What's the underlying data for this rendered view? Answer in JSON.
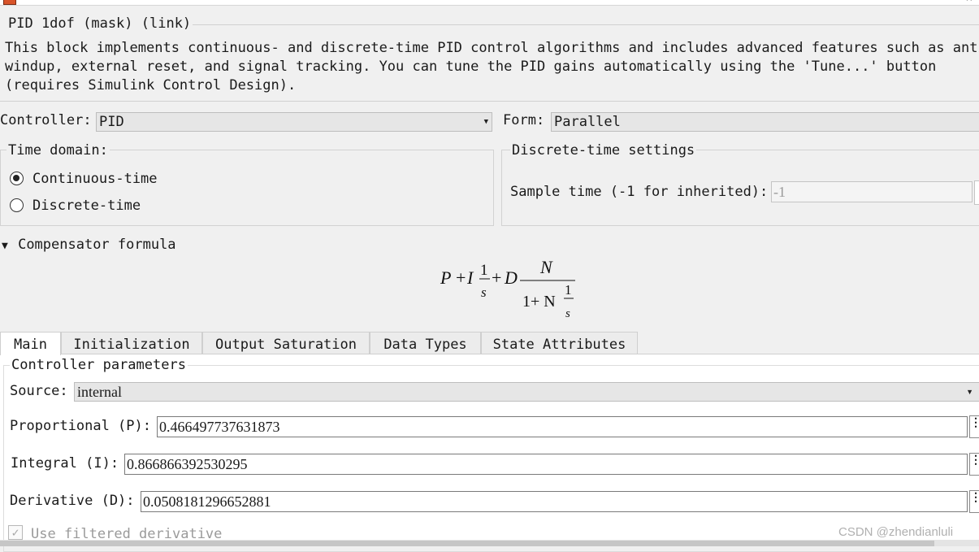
{
  "window": {
    "close_glyph": "×"
  },
  "block": {
    "title": "PID 1dof (mask) (link)",
    "description_lines": [
      "This block implements continuous- and discrete-time PID control algorithms and includes advanced features such as anti-",
      "windup, external reset, and signal tracking. You can tune the PID gains automatically using the 'Tune...' button",
      "(requires Simulink Control Design)."
    ]
  },
  "controller": {
    "label": "Controller:",
    "value": "PID"
  },
  "form": {
    "label": "Form:",
    "value": "Parallel"
  },
  "time_domain": {
    "label": "Time domain:",
    "options": [
      {
        "label": "Continuous-time",
        "selected": true
      },
      {
        "label": "Discrete-time",
        "selected": false
      }
    ]
  },
  "discrete_settings": {
    "label": "Discrete-time settings",
    "sample_time_label": "Sample time (-1 for inherited):",
    "sample_time_value": "-1"
  },
  "compensator": {
    "label": "Compensator formula",
    "formula": {
      "P": "P",
      "plus": "+",
      "I": "I",
      "one": "1",
      "s": "s",
      "D": "D",
      "N": "N",
      "denom_prefix": "1+ N"
    }
  },
  "tabs": [
    {
      "label": "Main",
      "active": true
    },
    {
      "label": "Initialization",
      "active": false
    },
    {
      "label": "Output Saturation",
      "active": false
    },
    {
      "label": "Data Types",
      "active": false
    },
    {
      "label": "State Attributes",
      "active": false
    }
  ],
  "params": {
    "group_label": "Controller parameters",
    "source_label": "Source:",
    "source_value": "internal",
    "proportional_label": "Proportional (P):",
    "proportional_value": "0.466497737631873",
    "integral_label": "Integral (I):",
    "integral_value": "0.866866392530295",
    "derivative_label": "Derivative (D):",
    "derivative_value": "0.0508181296652881",
    "use_filtered_label": "Use filtered derivative"
  },
  "watermark": "CSDN @zhendianluli"
}
